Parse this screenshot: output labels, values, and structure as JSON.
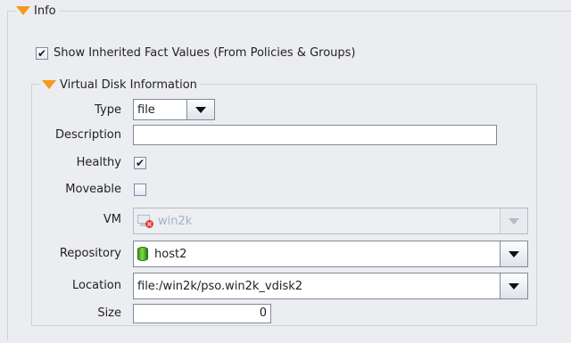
{
  "info": {
    "title": "Info",
    "show_inherited": {
      "label": "Show Inherited Fact Values (From Policies & Groups)",
      "checked": true
    }
  },
  "vdisk": {
    "title": "Virtual Disk Information",
    "type": {
      "label": "Type",
      "value": "file"
    },
    "description": {
      "label": "Description",
      "value": ""
    },
    "healthy": {
      "label": "Healthy",
      "checked": true
    },
    "moveable": {
      "label": "Moveable",
      "checked": false
    },
    "vm": {
      "label": "VM",
      "value": "win2k",
      "enabled": false
    },
    "repository": {
      "label": "Repository",
      "value": "host2"
    },
    "location": {
      "label": "Location",
      "value": "file:/win2k/pso.win2k_vdisk2"
    },
    "size": {
      "label": "Size",
      "value": "0"
    }
  },
  "icons": {
    "collapse": "orange-triangle-down-icon",
    "repository": "green-cylinder-icon",
    "vm": "vm-error-icon"
  },
  "colors": {
    "accent": "#f59a1c",
    "disabled_text": "#a4b3c8",
    "repo_icon": "#49b523"
  }
}
